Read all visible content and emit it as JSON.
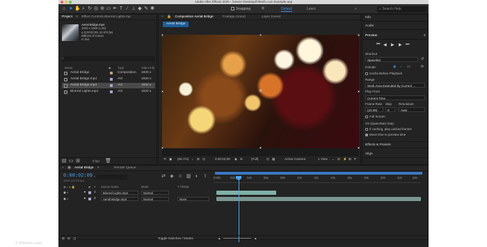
{
  "window": {
    "title": "Adobe After Effects 2020 - /Users/                    /Desktop/FileInfo.com Example.aep"
  },
  "toolbar": {
    "snapping": "Snapping",
    "workspaces": [
      "Default",
      "Learn"
    ],
    "search_placeholder": "Search Help"
  },
  "project": {
    "tab_label": "Project",
    "effect_controls_label": "Effect Controls Blurred Lights.mp",
    "item_name": "Aerial Bridge.mp4",
    "item_info": [
      "1920 x 1080 (1.00)",
      "Δ 0;00;00;09, 23.976 fps",
      "Millions of Colors",
      "H.264"
    ],
    "columns": {
      "name": "Name",
      "type": "Type",
      "video_info": "Video Info"
    },
    "rows": [
      {
        "name": "Aerial Bridge",
        "type": "Composition",
        "info": "1920 x",
        "color": "#b8a27a",
        "selected": false
      },
      {
        "name": "Aerial Bridge.mp4",
        "type": "AVI",
        "info": "1920 x",
        "color": "#a7a7c8",
        "selected": false
      },
      {
        "name": "Aerial Bridge.mp4",
        "type": "AVI",
        "info": "1920 x",
        "color": "#a7a7c8",
        "selected": true
      },
      {
        "name": "Blurred Lights.mp4",
        "type": "AVI",
        "info": "1920 x",
        "color": "#a7a7c8",
        "selected": false
      }
    ],
    "bpc": "8 bpc"
  },
  "composition": {
    "tab_label": "Composition Aerial Bridge",
    "footage_label": "Footage (none)",
    "layer_label": "Layer (none)",
    "flow_tab": "Aerial Bridge",
    "zoom": "(66.7%)",
    "timecode": "0;00;02;09",
    "resolution": "(Full)",
    "camera": "Active Camera",
    "views": "1 View"
  },
  "right": {
    "info": "Info",
    "audio": "Audio",
    "preview": "Preview",
    "shortcut_label": "Shortcut",
    "shortcut_value": "Spacebar",
    "include_label": "Include:",
    "cache": "Cache Before Playback",
    "range_label": "Range",
    "range_value": "Work Area Extended By Current ...",
    "play_from_label": "Play From",
    "play_from_value": "Current Time",
    "frame_rate_label": "Frame Rate",
    "skip_label": "Skip",
    "resolution_label": "Resolution",
    "frame_rate_value": "(23.98)",
    "skip_value": "0",
    "resolution_value": "Auto",
    "full_screen": "Full Screen",
    "stop_label": "On (Spacebar) Stop:",
    "if_caching": "If caching, play cached frames",
    "move_time": "Move time to preview time",
    "effects": "Effects & Presets",
    "align": "Align"
  },
  "timeline": {
    "comp_tab": "Aerial Bridge",
    "render_queue": "Render Queue",
    "timecode": "0:00:02:09",
    "fps": "00057 (23.976 fps)",
    "columns": {
      "source": "Source Name",
      "mode": "Mode",
      "trkmat": "T TrkMat",
      "parent": "Parent & Link"
    },
    "layers": [
      {
        "num": "1",
        "name": "Blurred Lights.mp4",
        "mode": "Normal",
        "parent": ""
      },
      {
        "num": "2",
        "name": "Aerial Bridge.mp4",
        "mode": "Normal",
        "trkmat": "None",
        "parent": ""
      }
    ],
    "ticks": [
      "0:00s",
      "02s",
      "04s",
      "06s",
      "08s",
      "10s",
      "12s",
      "14s",
      "16s",
      "18s",
      "20s",
      "22s",
      "24s"
    ],
    "toggle": "Toggle Switches / Modes"
  },
  "watermark": "© FileInfo.com",
  "colors": {
    "accent": "#3d8fe0",
    "timecode": "#4ea3f0",
    "layer1_bar": "#7fb1a7",
    "layer2_bar": "#7a9690"
  }
}
